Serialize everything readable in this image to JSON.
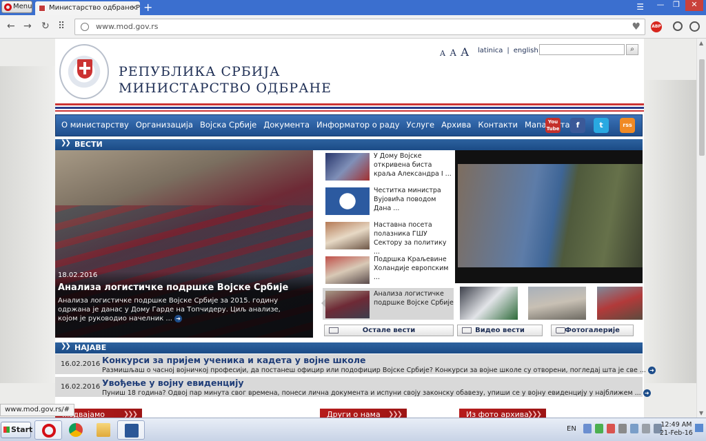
{
  "browser": {
    "menu_label": "Menu",
    "tab_title": "Министарство одбране Реп",
    "url": "www.mod.gov.rs",
    "status_url": "www.mod.gov.rs/#",
    "adblock_label": "ABP"
  },
  "header": {
    "title_line1": "РЕПУБЛИКА СРБИЈА",
    "title_line2": "МИНИСТАРСТВО ОДБРАНЕ",
    "font_sizes": [
      "A",
      "A",
      "A"
    ],
    "lang_latin": "latinica",
    "lang_sep": "|",
    "lang_english": "english"
  },
  "nav": {
    "items": [
      "О министарству",
      "Организација",
      "Војска Србије",
      "Документа",
      "Информатор о раду",
      "Услуге",
      "Архива",
      "Контакти",
      "Мапа сајта"
    ],
    "social": [
      "You Tube",
      "f",
      "t",
      "rss"
    ]
  },
  "news": {
    "section_label": "ВЕСТИ",
    "main": {
      "date": "18.02.2016",
      "title": "Анализа логистичке подршке Војске Србије",
      "text": "Анализа логистичке подршке Војске Србије за 2015. годину одржана је данас у Дому Гарде на Топчидеру. Циљ анализе, којом је руководио начелник ..."
    },
    "thumbs": [
      "У Дому Војске откривена биста краља Александра I ...",
      "Честитка министра Вујовића поводом Дана ...",
      "Наставна посета полазника ГШУ Сектору за политику ...",
      "Подршка Краљевине Холандије европским ...",
      "Анализа логистичке подршке Војске Србије"
    ],
    "buttons": {
      "other_news": "Остале вести",
      "video_news": "Видео вести",
      "photo_gallery": "Фотогалерије"
    }
  },
  "announcements": {
    "section_label": "НАЈАВЕ",
    "items": [
      {
        "date": "16.02.2016",
        "title": "Конкурси за пријем ученика и кадета у војне школе",
        "text": "Размишљаш о часној војничкој професији, да постанеш официр или подофицир Војске Србије? Конкурси за војне школе су отворени, погледај шта је све ..."
      },
      {
        "date": "16.02.2016",
        "title": "Увођење у војну евиденцију",
        "text": "Пуниш 18 година? Одвој пар минута свог времена, понеси лична документа и испуни своју законску обавезу, упиши се у војну евиденцију у најближем ..."
      }
    ]
  },
  "bottom_tabs": [
    "...здвајамо",
    "Други о нама",
    "Из фото архива"
  ],
  "taskbar": {
    "start_label": "Start",
    "lang": "EN",
    "time": "12:49 AM",
    "date": "21-Feb-16"
  },
  "colors": {
    "nav_blue": "#1f4e8c",
    "title_navy": "#1f2f55",
    "serbian_red": "#c33333"
  }
}
